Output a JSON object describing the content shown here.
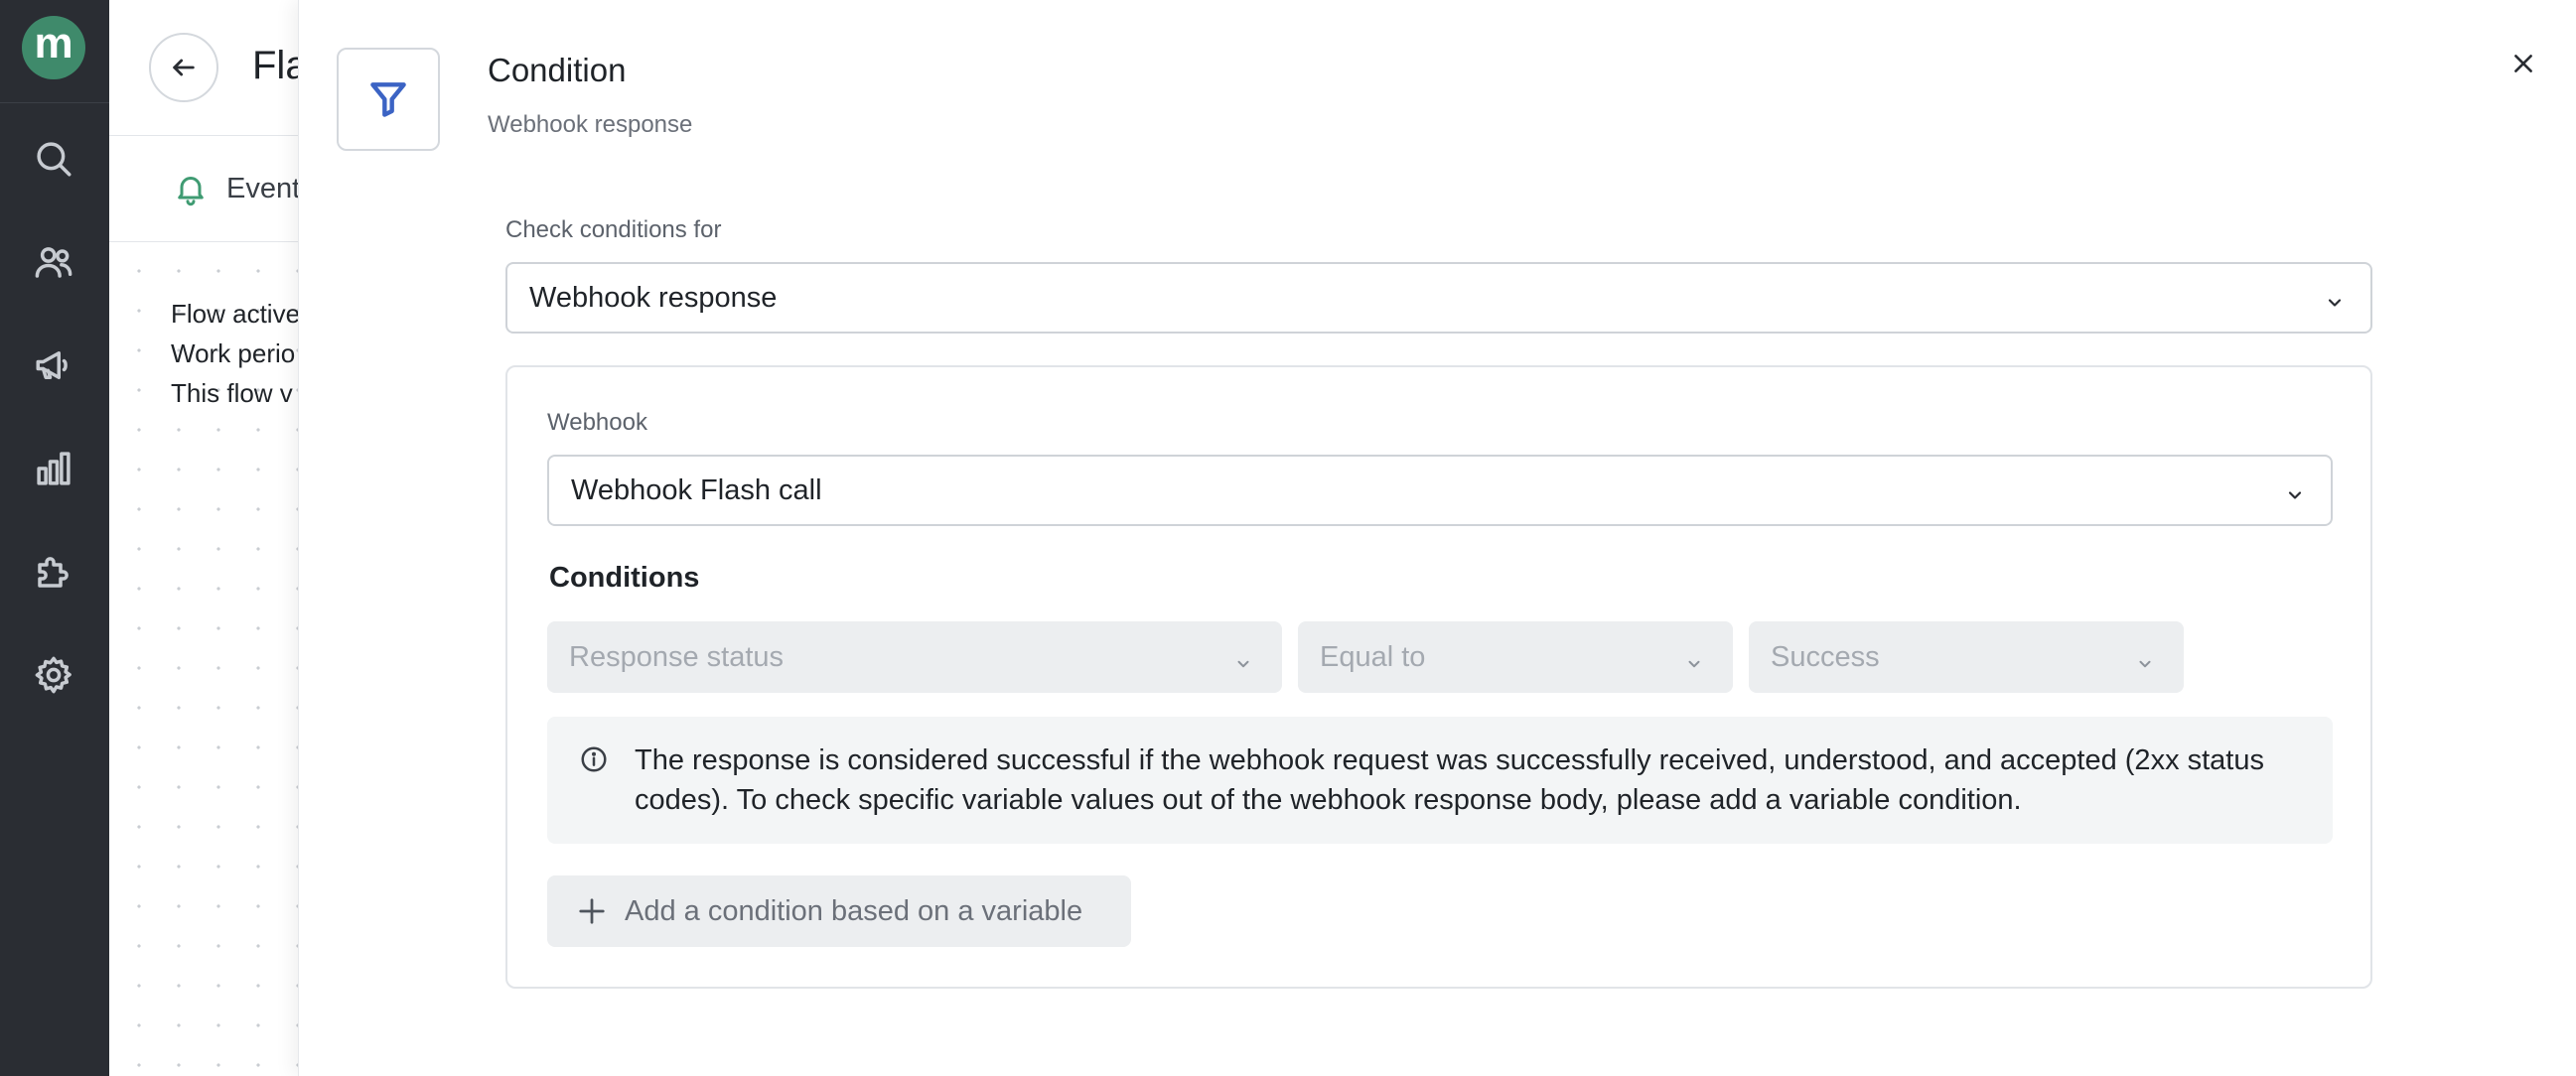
{
  "app": {
    "logo_letter": "m",
    "brand_color": "#3f8a6b"
  },
  "rail": {
    "icons": [
      "search-icon",
      "users-icon",
      "megaphone-icon",
      "bar-chart-icon",
      "puzzle-icon",
      "gear-icon"
    ]
  },
  "background_page": {
    "title": "Fla",
    "tab_label": "Event",
    "info_lines": [
      "Flow active",
      "Work perio",
      "This flow v"
    ]
  },
  "panel": {
    "title": "Condition",
    "subtitle": "Webhook response",
    "check_conditions_label": "Check conditions for",
    "check_conditions_value": "Webhook response",
    "webhook_label": "Webhook",
    "webhook_value": "Webhook Flash call",
    "conditions_heading": "Conditions",
    "condition_row": {
      "field": "Response status",
      "operator": "Equal to",
      "value": "Success"
    },
    "info_text": "The response is considered successful if the webhook request was successfully received, understood, and accepted (2xx status codes). To check specific variable values out of the webhook response body, please add a variable condition.",
    "add_condition_label": "Add a condition based on a variable"
  }
}
